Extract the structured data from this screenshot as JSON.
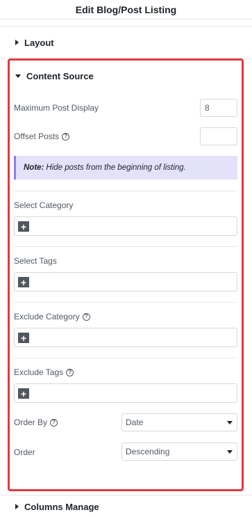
{
  "header": {
    "title": "Edit Blog/Post Listing"
  },
  "sections": {
    "layout": "Layout",
    "content_source": "Content Source",
    "columns_manage": "Columns Manage"
  },
  "content_source": {
    "max_post_display": {
      "label": "Maximum Post Display",
      "value": "8"
    },
    "offset_posts": {
      "label": "Offset Posts",
      "value": ""
    },
    "note": {
      "prefix": "Note:",
      "text": "Hide posts from the beginning of listing."
    },
    "select_category": {
      "label": "Select Category",
      "add": "+"
    },
    "select_tags": {
      "label": "Select Tags",
      "add": "+"
    },
    "exclude_category": {
      "label": "Exclude Category",
      "add": "+"
    },
    "exclude_tags": {
      "label": "Exclude Tags",
      "add": "+"
    },
    "order_by": {
      "label": "Order By",
      "selected": "Date"
    },
    "order": {
      "label": "Order",
      "selected": "Descending"
    }
  },
  "icons": {
    "help": "?"
  },
  "colors": {
    "highlight_border": "#dd3a3f",
    "note_bg": "#e4e1fb",
    "note_accent": "#8d7fe8"
  }
}
